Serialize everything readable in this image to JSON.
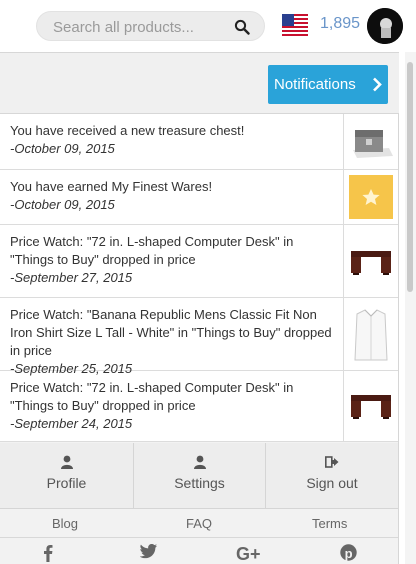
{
  "header": {
    "search_placeholder": "Search all products...",
    "points": "1,895"
  },
  "notifications_button": "Notifications",
  "notifications": [
    {
      "text": "You have received a new treasure chest!",
      "date": "-October 09, 2015",
      "thumb": "treasure-chest-icon"
    },
    {
      "text": "You have earned My Finest Wares!",
      "date": "-October 09, 2015",
      "thumb": "star-badge-icon"
    },
    {
      "text": "Price Watch: \"72 in. L-shaped Computer Desk\" in \"Things to Buy\" dropped in price",
      "date": "-September 27, 2015",
      "thumb": "desk-image"
    },
    {
      "text": "Price Watch: \"Banana Republic Mens Classic Fit Non Iron Shirt Size L Tall - White\" in \"Things to Buy\" dropped in price",
      "date": "-September 25, 2015",
      "thumb": "shirt-image"
    },
    {
      "text": "Price Watch: \"72 in. L-shaped Computer Desk\" in \"Things to Buy\" dropped in price",
      "date": "-September 24, 2015",
      "thumb": "desk-image"
    }
  ],
  "account": {
    "profile": "Profile",
    "settings": "Settings",
    "signout": "Sign out"
  },
  "footer_links": {
    "blog": "Blog",
    "faq": "FAQ",
    "terms": "Terms"
  },
  "social": [
    "facebook-icon",
    "twitter-icon",
    "google-plus-icon",
    "pinterest-icon"
  ],
  "colors": {
    "accent": "#2aa3d9",
    "points": "#6a95c9",
    "badge": "#f6c54a"
  }
}
